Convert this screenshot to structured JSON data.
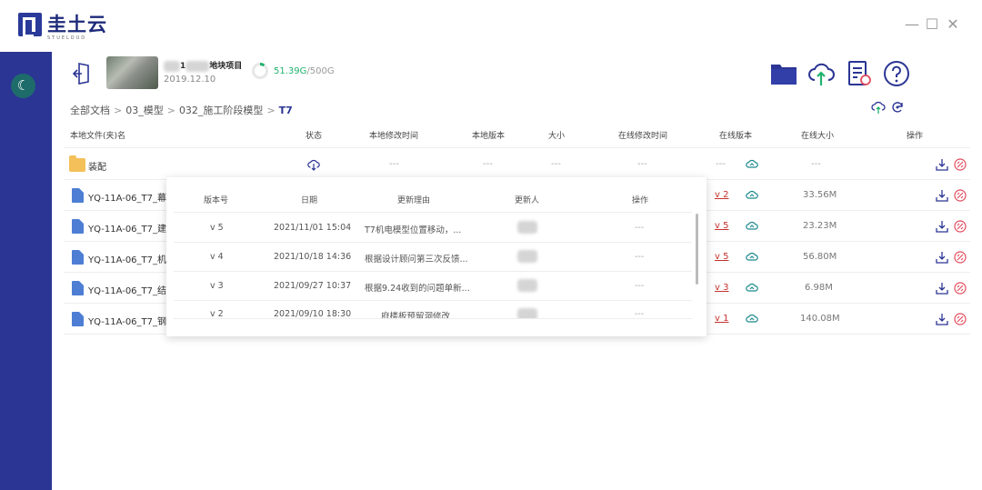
{
  "app": {
    "name": "圭土云",
    "sub": "STUELOUD"
  },
  "window": {
    "min": "—",
    "max": "☐",
    "close": "✕"
  },
  "project": {
    "name_visible": "1",
    "name_suffix": "地块项目",
    "date": "2019.12.10",
    "storage_used": "51.39G",
    "storage_total": "/500G",
    "storage_fraction": 0.1028
  },
  "breadcrumb": [
    "全部文档",
    "03_模型",
    "032_施工阶段模型",
    "T7"
  ],
  "breadcrumb_sep": ">",
  "columns": [
    "本地文件(夹)名",
    "状态",
    "本地修改时间",
    "本地版本",
    "大小",
    "在线修改时间",
    "在线版本",
    "在线大小",
    "操作"
  ],
  "rows": [
    {
      "name": "装配",
      "type": "folder",
      "local_time": "---",
      "local_ver": "---",
      "size": "---",
      "online_time": "---",
      "online_ver": "---",
      "online_size": "---"
    },
    {
      "name": "YQ-11A-06_T7_幕墙",
      "type": "file",
      "online_ver": "v 2",
      "online_size": "33.56M"
    },
    {
      "name": "YQ-11A-06_T7_建筑",
      "type": "file",
      "online_ver": "v 5",
      "online_size": "23.23M"
    },
    {
      "name": "YQ-11A-06_T7_机电",
      "type": "file",
      "online_ver": "v 5",
      "online_size": "56.80M"
    },
    {
      "name": "YQ-11A-06_T7_结构",
      "type": "file",
      "online_ver": "v 3",
      "online_size": "6.98M"
    },
    {
      "name": "YQ-11A-06_T7_钢结",
      "type": "file",
      "online_ver": "v 1",
      "online_size": "140.08M"
    }
  ],
  "popup": {
    "columns": [
      "版本号",
      "日期",
      "更新理由",
      "更新人",
      "操作"
    ],
    "rows": [
      {
        "ver": "v 5",
        "date": "2021/11/01 15:04",
        "reason": "T7机电模型位置移动，...",
        "action": "---"
      },
      {
        "ver": "v 4",
        "date": "2021/10/18 14:36",
        "reason": "根据设计顾问第三次反馈...",
        "action": "---"
      },
      {
        "ver": "v 3",
        "date": "2021/09/27 10:37",
        "reason": "根据9.24收到的问题单新...",
        "action": "---"
      },
      {
        "ver": "v 2",
        "date": "2021/09/10 18:30",
        "reason": "府楼板预留洞修改",
        "action": "---"
      }
    ]
  },
  "colors": {
    "sidebar": "#2b3594",
    "accent": "#2b3594",
    "green": "#21b36e",
    "red": "#c4322d",
    "cloud": "#1f8a8f"
  },
  "icons": [
    "exit-icon",
    "folder-icon",
    "cloud-upload-icon",
    "report-icon",
    "help-icon",
    "cloud-sync-icon",
    "refresh-icon",
    "download-icon",
    "unlink-icon",
    "moon-icon"
  ]
}
